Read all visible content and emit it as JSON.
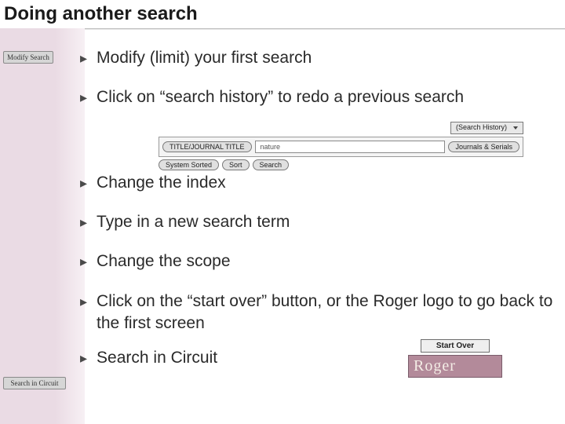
{
  "title": "Doing another search",
  "chip_modify": "Modify Search",
  "chip_circuit": "Search in Circuit",
  "bullets": {
    "b1": "Modify (limit) your first search",
    "b2": "Click on “search history” to redo a previous search",
    "b3": "Change the index",
    "b4": "Type in a new search term",
    "b5": "Change the scope",
    "b6": "Click on the “start over” button, or the Roger logo to go back to the first screen",
    "b7": "Search in Circuit"
  },
  "mini": {
    "history": "(Search History)",
    "index": "TITLE/JOURNAL TITLE",
    "term": "nature",
    "scope": "Journals & Serials",
    "sorted": "System Sorted",
    "sort": "Sort",
    "search": "Search"
  },
  "startover": "Start Over",
  "roger": "Roger"
}
